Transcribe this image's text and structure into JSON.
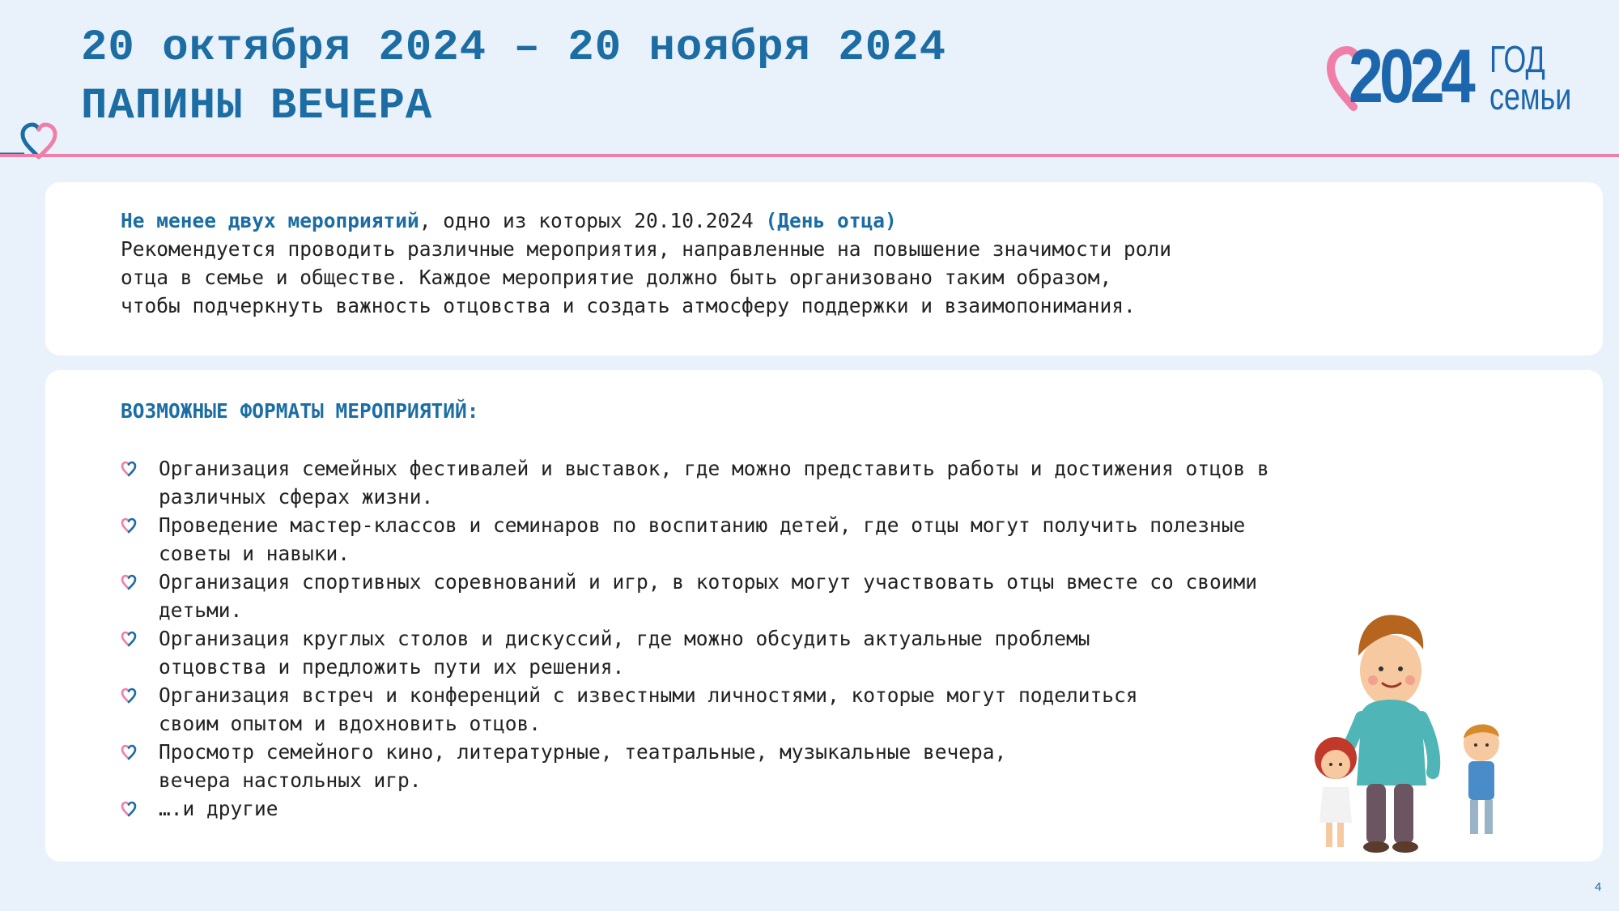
{
  "header": {
    "dates": "20 октября 2024 – 20 ноября 2024",
    "title": "ПАПИНЫ ВЕЧЕРА"
  },
  "logo": {
    "year": "2024",
    "line1": "ГОД",
    "line2": "семьи",
    "heart_icon": "heart-icon"
  },
  "intro": {
    "bold_lead": "Не менее двух мероприятий",
    "lead_rest": ", одно из которых 20.10.2024 ",
    "bold_tail": "(День отца)",
    "lines": [
      "Рекомендуется проводить различные мероприятия, направленные на повышение значимости роли",
      "отца в семье и обществе. Каждое мероприятие должно быть организовано таким образом,",
      "чтобы подчеркнуть важность отцовства и создать атмосферу поддержки и взаимопонимания."
    ]
  },
  "formats": {
    "title": "ВОЗМОЖНЫЕ ФОРМАТЫ МЕРОПРИЯТИЙ:",
    "items": [
      [
        "Организация семейных фестивалей и выставок, где можно представить работы и достижения отцов в",
        "различных сферах жизни."
      ],
      [
        "Проведение мастер-классов и семинаров по воспитанию детей, где отцы могут получить полезные",
        "советы и навыки."
      ],
      [
        "Организация спортивных соревнований и игр, в которых могут участвовать отцы вместе со своими",
        "детьми."
      ],
      [
        "Организация круглых столов и дискуссий, где можно обсудить актуальные проблемы",
        "отцовства и предложить пути их решения."
      ],
      [
        "Организация встреч и конференций с известными личностями, которые могут поделиться",
        "своим опытом и вдохновить отцов."
      ],
      [
        "Просмотр семейного кино, литературные, театральные, музыкальные вечера,",
        "вечера настольных игр."
      ],
      [
        "….и другие"
      ]
    ]
  },
  "colors": {
    "accent_blue": "#1b6da3",
    "pink": "#ef7fa9",
    "background": "#e9f1fa"
  },
  "page_number": "4"
}
